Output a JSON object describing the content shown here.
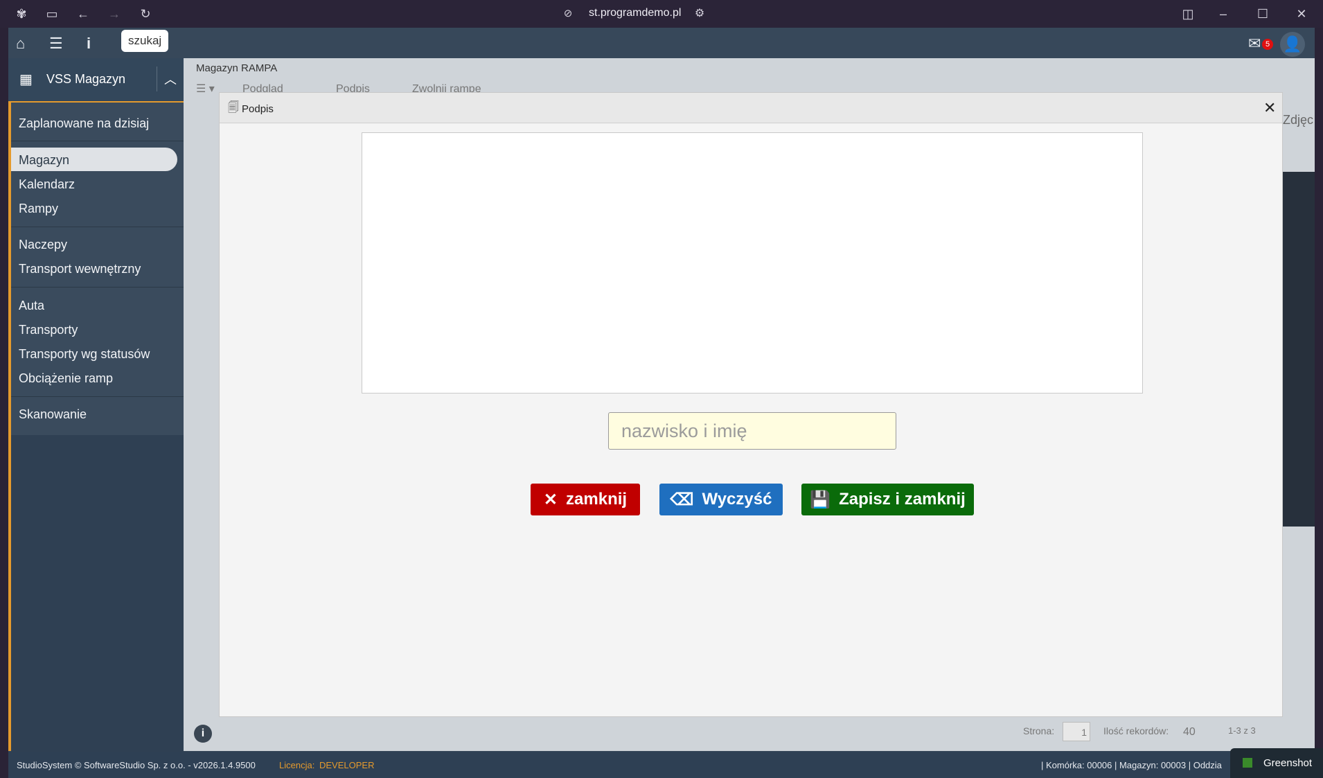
{
  "browser": {
    "url": "st.programdemo.pl"
  },
  "topbar": {
    "search_label": "szukaj",
    "mail_badge": "5"
  },
  "sidebar": {
    "title": "VSS Magazyn",
    "items": [
      {
        "label": "Zaplanowane na dzisiaj"
      },
      {
        "label": "Magazyn"
      },
      {
        "label": "Kalendarz"
      },
      {
        "label": "Rampy"
      },
      {
        "label": "Naczepy"
      },
      {
        "label": "Transport wewnętrzny"
      },
      {
        "label": "Auta"
      },
      {
        "label": "Transporty"
      },
      {
        "label": "Transporty wg statusów"
      },
      {
        "label": "Obciążenie ramp"
      },
      {
        "label": "Skanowanie"
      }
    ]
  },
  "content": {
    "title": "Magazyn RAMPA",
    "toolbar": {
      "podglad": "Podgląd",
      "podpis": "Podpis",
      "zwolnij": "Zwolnij rampę"
    },
    "right_col": "Zdjęc",
    "pager": {
      "page_label": "Strona:",
      "page_value": "1",
      "records_label": "Ilość rekordów:",
      "records_value": "40",
      "range": "1-3 z 3"
    }
  },
  "modal": {
    "title": "Podpis",
    "input_placeholder": "nazwisko i imię",
    "close_label": "zamknij",
    "clear_label": "Wyczyść",
    "save_label": "Zapisz i zamknij"
  },
  "statusbar": {
    "copyright": "StudioSystem © SoftwareStudio Sp. z o.o. - v2026.1.4.9500",
    "license_label": "Licencja:",
    "license_value": "DEVELOPER",
    "right_info": "| Komórka: 00006 | Magazyn: 00003 | Oddzia",
    "greenshot": "Greenshot"
  },
  "colors": {
    "accent_orange": "#e59a2d",
    "btn_red": "#c00000",
    "btn_blue": "#1f6fbf",
    "btn_green": "#0a6b0a"
  }
}
